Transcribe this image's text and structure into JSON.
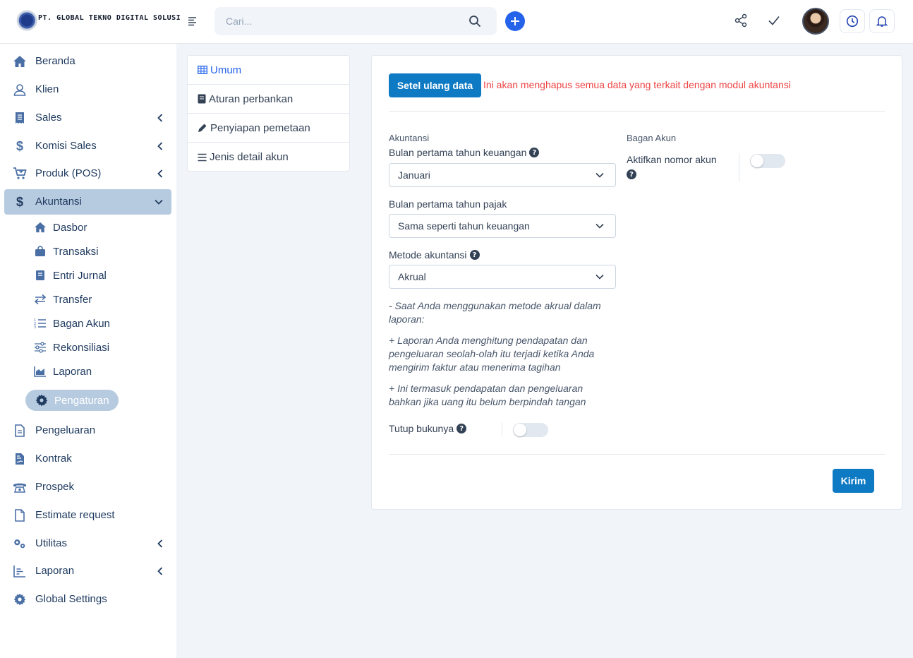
{
  "brand": {
    "name": "PT. GLOBAL TEKNO DIGITAL SOLUSI"
  },
  "header": {
    "search_placeholder": "Cari...",
    "icons": [
      "menu-icon",
      "search-icon",
      "plus-icon",
      "share-icon",
      "check-icon",
      "clock-icon",
      "bell-icon"
    ]
  },
  "sidebar": {
    "items": [
      {
        "label": "Beranda",
        "icon": "home-icon"
      },
      {
        "label": "Klien",
        "icon": "user-icon"
      },
      {
        "label": "Sales",
        "icon": "receipt-icon",
        "has_children": true
      },
      {
        "label": "Komisi Sales",
        "icon": "dollar-icon",
        "has_children": true
      },
      {
        "label": "Produk (POS)",
        "icon": "cart-icon",
        "has_children": true
      },
      {
        "label": "Akuntansi",
        "icon": "dollar-icon",
        "has_children": true,
        "expanded": true
      },
      {
        "label": "Pengeluaran",
        "icon": "file-icon"
      },
      {
        "label": "Kontrak",
        "icon": "contract-icon"
      },
      {
        "label": "Prospek",
        "icon": "phone-icon"
      },
      {
        "label": "Estimate request",
        "icon": "document-icon"
      },
      {
        "label": "Utilitas",
        "icon": "gears-icon",
        "has_children": true
      },
      {
        "label": "Laporan",
        "icon": "bar-chart-icon",
        "has_children": true
      },
      {
        "label": "Global Settings",
        "icon": "gear-icon"
      }
    ],
    "submenu": [
      {
        "label": "Dasbor",
        "icon": "home-icon"
      },
      {
        "label": "Transaksi",
        "icon": "bag-icon"
      },
      {
        "label": "Entri Jurnal",
        "icon": "book-icon"
      },
      {
        "label": "Transfer",
        "icon": "transfer-icon"
      },
      {
        "label": "Bagan Akun",
        "icon": "list-ordered-icon"
      },
      {
        "label": "Rekonsiliasi",
        "icon": "sliders-icon"
      },
      {
        "label": "Laporan",
        "icon": "area-chart-icon"
      },
      {
        "label": "Pengaturan",
        "icon": "gear-icon",
        "active": true
      }
    ]
  },
  "settings_menu": [
    {
      "label": "Umum",
      "icon": "table-icon",
      "selected": true
    },
    {
      "label": "Aturan perbankan",
      "icon": "book-icon"
    },
    {
      "label": "Penyiapan pemetaan",
      "icon": "pencil-icon"
    },
    {
      "label": "Jenis detail akun",
      "icon": "list-icon"
    }
  ],
  "main": {
    "reset_button": "Setel ulang data",
    "reset_warning": "Ini akan menghapus semua data yang terkait dengan modul akuntansi",
    "accounting_section": "Akuntansi",
    "fiscal_month_label": "Bulan pertama tahun keuangan",
    "fiscal_month_value": "Januari",
    "tax_month_label": "Bulan pertama tahun pajak",
    "tax_month_value": "Sama seperti tahun keuangan",
    "method_label": "Metode akuntansi",
    "method_value": "Akrual",
    "notes": [
      "- Saat Anda menggunakan metode akrual dalam laporan:",
      "+ Laporan Anda menghitung pendapatan dan pengeluaran seolah-olah itu terjadi ketika Anda mengirim faktur atau menerima tagihan",
      "+ Ini termasuk pendapatan dan pengeluaran bahkan jika uang itu belum berpindah tangan"
    ],
    "close_books_label": "Tutup bukunya",
    "close_books_enabled": false,
    "chart_section": "Bagan Akun",
    "enable_account_number_label": "Aktifkan nomor akun",
    "enable_account_number_enabled": false,
    "help_icon": "?",
    "submit_button": "Kirim"
  },
  "colors": {
    "primary": "#0e7ac4",
    "accent": "#2563eb",
    "danger": "#ef4444",
    "active_nav": "#b7cbe0"
  }
}
